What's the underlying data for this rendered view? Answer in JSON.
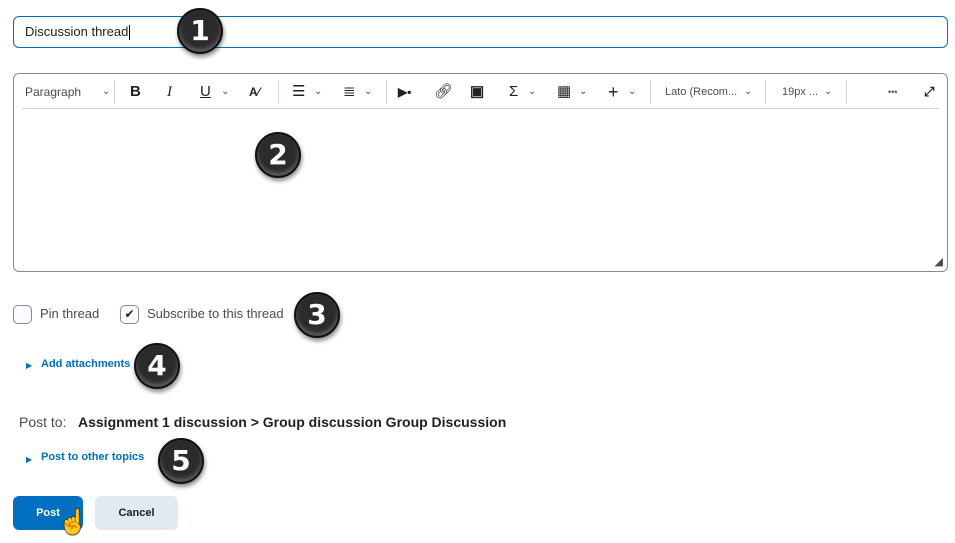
{
  "title_input": {
    "value": "Discussion thread"
  },
  "toolbar": {
    "format_label": "Paragraph",
    "bold": "B",
    "italic": "I",
    "underline": "U",
    "font_label": "Lato (Recom...",
    "size_label": "19px ...",
    "more": "•••"
  },
  "options": {
    "pin_label": "Pin thread",
    "pin_checked": false,
    "subscribe_label": "Subscribe to this thread",
    "subscribe_checked": true
  },
  "attachments_link": "Add attachments",
  "post_to": {
    "label": "Post to:",
    "value": "Assignment 1 discussion > Group discussion Group Discussion"
  },
  "other_topics_link": "Post to other topics",
  "buttons": {
    "post": "Post",
    "cancel": "Cancel"
  },
  "callouts": [
    "1",
    "2",
    "3",
    "4",
    "5"
  ],
  "colors": {
    "accent": "#006fbf",
    "cancel_bg": "#e3e9f1",
    "callout": "#2b2b2b"
  }
}
